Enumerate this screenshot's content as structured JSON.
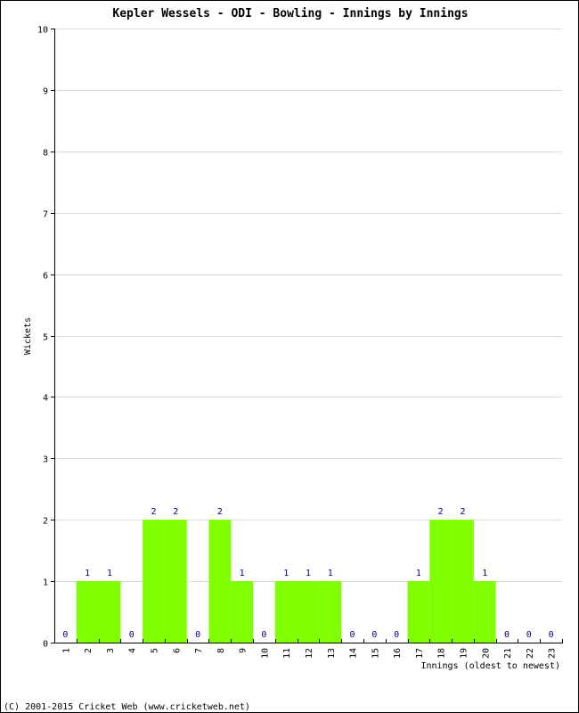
{
  "chart_data": {
    "type": "bar",
    "title": "Kepler Wessels - ODI - Bowling - Innings by Innings",
    "xlabel": "Innings (oldest to newest)",
    "ylabel": "Wickets",
    "ylim": [
      0,
      10
    ],
    "yticks": [
      0,
      1,
      2,
      3,
      4,
      5,
      6,
      7,
      8,
      9,
      10
    ],
    "grid": true,
    "categories": [
      "1",
      "2",
      "3",
      "4",
      "5",
      "6",
      "7",
      "8",
      "9",
      "10",
      "11",
      "12",
      "13",
      "14",
      "15",
      "16",
      "17",
      "18",
      "19",
      "20",
      "21",
      "22",
      "23"
    ],
    "values": [
      0,
      1,
      1,
      0,
      2,
      2,
      0,
      2,
      1,
      0,
      1,
      1,
      1,
      0,
      0,
      0,
      1,
      2,
      2,
      1,
      0,
      0,
      0
    ],
    "bar_color": "#80ff00",
    "label_color": "#000080",
    "grid_color": "#dcdcdc"
  },
  "footer": "(C) 2001-2015 Cricket Web (www.cricketweb.net)"
}
